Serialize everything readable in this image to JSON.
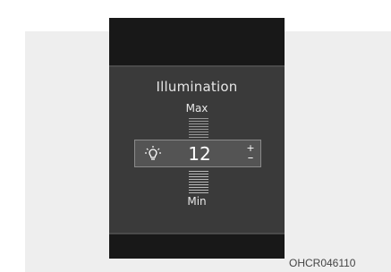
{
  "display": {
    "title": "Illumination",
    "max_label": "Max",
    "min_label": "Min",
    "value": "12",
    "icons": {
      "bulb": "light-bulb-icon",
      "increase": "plus-icon",
      "decrease": "minus-icon"
    },
    "increase_symbol": "+",
    "decrease_symbol": "–"
  },
  "caption": "OHCR046110",
  "colors": {
    "screen_bg": "#181818",
    "panel_bg": "#3a3a3a",
    "selection_bg": "#545454",
    "text": "#e6e6e6"
  }
}
